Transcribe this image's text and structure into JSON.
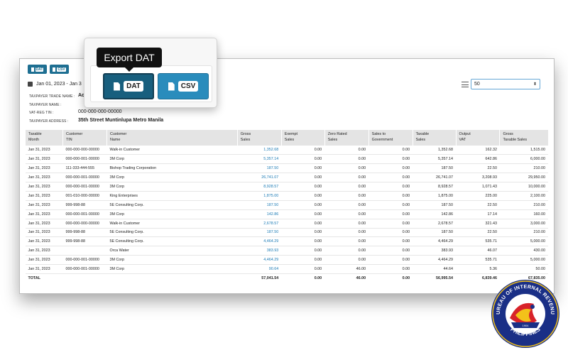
{
  "toolbar": {
    "dat_small_label": "DAT",
    "csv_small_label": "CSV"
  },
  "popover": {
    "tooltip": "Export DAT",
    "dat_label": "DAT",
    "csv_label": "CSV"
  },
  "filters": {
    "date_range": "Jan 01, 2023 - Jan 3",
    "page_size": "50"
  },
  "taxpayer": {
    "trade_name_label": "TAXPAYER TRADE NAME :",
    "trade_name_value": "Ac",
    "name_label": "TAXPAYER NAME :",
    "tin_label": "VAT-REG TIN :",
    "tin_value": "000-000-000-00000",
    "address_label": "TAXPAYER ADDRESS :",
    "address_value": "35th Street Muntinlupa Metro Manila"
  },
  "table": {
    "headers": [
      [
        "Taxable",
        "Month"
      ],
      [
        "Customer",
        "TIN"
      ],
      [
        "Customer",
        "Name"
      ],
      [
        "Gross",
        "Sales"
      ],
      [
        "Exempt",
        "Sales"
      ],
      [
        "Zero Rated",
        "Sales"
      ],
      [
        "Sales to",
        "Government"
      ],
      [
        "Taxable",
        "Sales"
      ],
      [
        "Output",
        "VAT"
      ],
      [
        "Gross",
        "Taxable Sales"
      ]
    ],
    "rows": [
      [
        "Jan 31, 2023",
        "000-000-000-00000",
        "Walk-in Customer",
        "1,352.68",
        "0.00",
        "0.00",
        "0.00",
        "1,352.68",
        "162.32",
        "1,515.00"
      ],
      [
        "Jan 31, 2023",
        "000-000-001-00000",
        "3M Corp",
        "5,357.14",
        "0.00",
        "0.00",
        "0.00",
        "5,357.14",
        "642.86",
        "6,000.00"
      ],
      [
        "Jan 31, 2023",
        "111-333-444-555",
        "Bishop Trading Corporation",
        "187.50",
        "0.00",
        "0.00",
        "0.00",
        "187.50",
        "22.50",
        "210.00"
      ],
      [
        "Jan 31, 2023",
        "000-000-001-00000",
        "3M Corp",
        "26,741.07",
        "0.00",
        "0.00",
        "0.00",
        "26,741.07",
        "3,208.93",
        "29,950.00"
      ],
      [
        "Jan 31, 2023",
        "000-000-001-00000",
        "3M Corp",
        "8,928.57",
        "0.00",
        "0.00",
        "0.00",
        "8,928.57",
        "1,071.43",
        "10,000.00"
      ],
      [
        "Jan 31, 2023",
        "001-010-000-00000",
        "King Enterprises",
        "1,875.00",
        "0.00",
        "0.00",
        "0.00",
        "1,875.00",
        "225.00",
        "2,100.00"
      ],
      [
        "Jan 31, 2023",
        "999-998-88",
        "5E Consulting Corp.",
        "187.50",
        "0.00",
        "0.00",
        "0.00",
        "187.50",
        "22.50",
        "210.00"
      ],
      [
        "Jan 31, 2023",
        "000-000-001-00000",
        "3M Corp",
        "142.86",
        "0.00",
        "0.00",
        "0.00",
        "142.86",
        "17.14",
        "160.00"
      ],
      [
        "Jan 31, 2023",
        "000-000-000-00000",
        "Walk-in Customer",
        "2,678.57",
        "0.00",
        "0.00",
        "0.00",
        "2,678.57",
        "321.43",
        "3,000.00"
      ],
      [
        "Jan 31, 2023",
        "999-998-88",
        "5E Consulting Corp.",
        "187.50",
        "0.00",
        "0.00",
        "0.00",
        "187.50",
        "22.50",
        "210.00"
      ],
      [
        "Jan 31, 2023",
        "999-998-88",
        "5E Consulting Corp.",
        "4,464.29",
        "0.00",
        "0.00",
        "0.00",
        "4,464.29",
        "535.71",
        "5,000.00"
      ],
      [
        "Jan 31, 2023",
        "",
        "Orca Water",
        "383.93",
        "0.00",
        "0.00",
        "0.00",
        "383.93",
        "46.07",
        "430.00"
      ],
      [
        "Jan 31, 2023",
        "000-000-001-00000",
        "3M Corp",
        "4,464.29",
        "0.00",
        "0.00",
        "0.00",
        "4,464.29",
        "535.71",
        "5,000.00"
      ],
      [
        "Jan 31, 2023",
        "000-000-001-00000",
        "3M Corp",
        "90.64",
        "0.00",
        "46.00",
        "0.00",
        "44.64",
        "5.36",
        "50.00"
      ]
    ],
    "total": [
      "TOTAL",
      "",
      "",
      "57,041.54",
      "0.00",
      "46.00",
      "0.00",
      "56,995.54",
      "6,839.46",
      "67,835.00"
    ]
  },
  "seal": {
    "text_top": "BUREAU OF INTERNAL REVENUE",
    "text_bottom": "PHILIPPINES",
    "year": "1904"
  },
  "colors": {
    "primary_button": "#185f7e",
    "secondary_button": "#2a8cbc",
    "link_value": "#1a7ab5",
    "header_bg": "#e4e4e4"
  }
}
